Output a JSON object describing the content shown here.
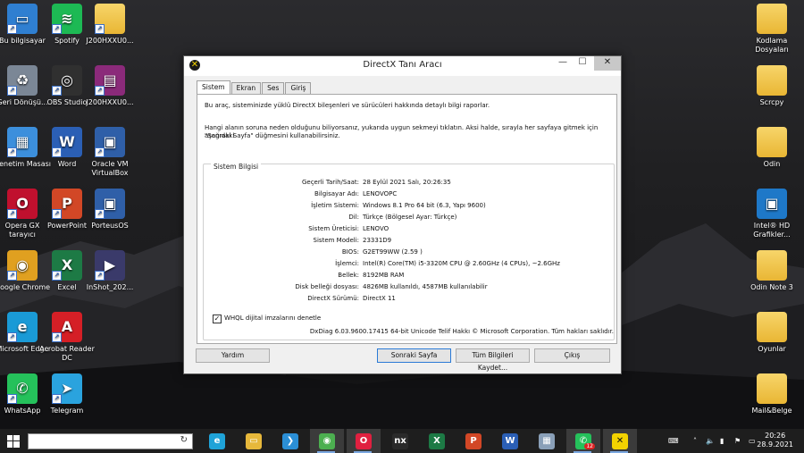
{
  "desktop": {
    "icons_left": [
      {
        "label": "Bu bilgisayar",
        "icon": "computer-icon"
      },
      {
        "label": "Spotify",
        "icon": "spotify-icon"
      },
      {
        "label": "J200HXXU0...",
        "icon": "folder-icon"
      },
      {
        "label": "Geri Dönüşü...",
        "icon": "recycle-bin-icon"
      },
      {
        "label": "OBS Studio",
        "icon": "obs-icon"
      },
      {
        "label": "J200HXXU0...",
        "icon": "winrar-icon"
      },
      {
        "label": "Denetim Masası",
        "icon": "control-panel-icon"
      },
      {
        "label": "Word",
        "icon": "word-icon"
      },
      {
        "label": "Oracle VM VirtualBox",
        "icon": "virtualbox-icon"
      },
      {
        "label": "Opera GX tarayıcı",
        "icon": "opera-gx-icon"
      },
      {
        "label": "PowerPoint",
        "icon": "powerpoint-icon"
      },
      {
        "label": "PorteusOS",
        "icon": "virtualbox-icon"
      },
      {
        "label": "Google Chrome",
        "icon": "chrome-icon"
      },
      {
        "label": "Excel",
        "icon": "excel-icon"
      },
      {
        "label": "InShot_202...",
        "icon": "video-file-icon"
      },
      {
        "label": "Microsoft Edge",
        "icon": "edge-icon"
      },
      {
        "label": "Acrobat Reader DC",
        "icon": "acrobat-icon"
      },
      {
        "label": "WhatsApp",
        "icon": "whatsapp-icon"
      },
      {
        "label": "Telegram",
        "icon": "telegram-icon"
      }
    ],
    "icons_right": [
      {
        "label": "Kodlama Dosyaları",
        "icon": "folder-icon"
      },
      {
        "label": "Scrcpy",
        "icon": "folder-icon"
      },
      {
        "label": "Odin",
        "icon": "folder-icon"
      },
      {
        "label": "Intel® HD Grafikler...",
        "icon": "intel-graphics-icon"
      },
      {
        "label": "Odin Note 3",
        "icon": "folder-icon"
      },
      {
        "label": "Oyunlar",
        "icon": "folder-icon"
      },
      {
        "label": "Mail&Belge",
        "icon": "folder-icon"
      }
    ]
  },
  "window": {
    "title": "DirectX Tanı Aracı",
    "controls": {
      "minimize": "—",
      "maximize": "☐",
      "close": "✕"
    },
    "tabs": [
      "Sistem",
      "Ekran",
      "Ses",
      "Giriş"
    ],
    "intro1": "Bu araç, sisteminizde yüklü DirectX bileşenleri ve sürücüleri hakkında detaylı bilgi raporlar.",
    "intro2a": "Hangi alanın soruna neden olduğunu biliyorsanız, yukarıda uygun sekmeyi tıklatın.  Aksi halde, sırayla her sayfaya gitmek için aşağıdaki",
    "intro2b": "\"Sonraki Sayfa\" düğmesini kullanabilirsiniz.",
    "group_title": "Sistem Bilgisi",
    "info": [
      {
        "key": "Geçerli Tarih/Saat:",
        "value": "28 Eylül 2021 Salı, 20:26:35"
      },
      {
        "key": "Bilgisayar Adı:",
        "value": "LENOVOPC"
      },
      {
        "key": "İşletim Sistemi:",
        "value": "Windows 8.1 Pro 64 bit (6.3, Yapı 9600)"
      },
      {
        "key": "Dil:",
        "value": "Türkçe (Bölgesel Ayar: Türkçe)"
      },
      {
        "key": "Sistem Üreticisi:",
        "value": "LENOVO"
      },
      {
        "key": "Sistem Modeli:",
        "value": "23331D9"
      },
      {
        "key": "BIOS:",
        "value": "G2ET99WW (2.59 )"
      },
      {
        "key": "İşlemci:",
        "value": "Intel(R) Core(TM) i5-3320M CPU @ 2.60GHz (4 CPUs), ~2.6GHz"
      },
      {
        "key": "Bellek:",
        "value": "8192MB RAM"
      },
      {
        "key": "Disk belleği dosyası:",
        "value": "4826MB kullanıldı, 4587MB kullanılabilir"
      },
      {
        "key": "DirectX Sürümü:",
        "value": "DirectX 11"
      }
    ],
    "whql_label": "WHQL dijital imzalarını denetle",
    "whql_checked": true,
    "copyright": "DxDiag 6.03.9600.17415 64-bit Unicode  Telif Hakkı © Microsoft Corporation. Tüm hakları saklıdır.",
    "buttons": {
      "help": "Yardım",
      "next": "Sonraki Sayfa",
      "save_all": "Tüm Bilgileri Kaydet...",
      "exit": "Çıkış"
    }
  },
  "taskbar": {
    "start_icon": "windows-logo-icon",
    "refresh_icon": "↻",
    "apps": [
      {
        "name": "edge",
        "icon": "edge-icon",
        "color": "#1fa3d8"
      },
      {
        "name": "explorer",
        "icon": "file-explorer-icon",
        "color": "#e7b83b"
      },
      {
        "name": "vscode",
        "icon": "vscode-icon",
        "color": "#2b8fd6"
      },
      {
        "name": "chrome",
        "icon": "chrome-icon",
        "color": "#4caf50",
        "active": true
      },
      {
        "name": "opera-gx",
        "icon": "opera-gx-icon",
        "color": "#e02040",
        "active": true
      },
      {
        "name": "nox",
        "icon": "nox-icon",
        "color": "#2a2a2a"
      },
      {
        "name": "excel",
        "icon": "excel-icon",
        "color": "#1d7a45"
      },
      {
        "name": "powerpoint",
        "icon": "powerpoint-icon",
        "color": "#d24726"
      },
      {
        "name": "word",
        "icon": "word-icon",
        "color": "#2b5fb5"
      },
      {
        "name": "control-panel",
        "icon": "control-panel-icon",
        "color": "#8aa0b8"
      },
      {
        "name": "whatsapp",
        "icon": "whatsapp-icon",
        "color": "#25c15b",
        "active": true,
        "badge": "12"
      },
      {
        "name": "dxdiag",
        "icon": "directx-icon",
        "color": "#f2d200",
        "active": true
      }
    ],
    "time": "20:26",
    "date": "28.9.2021"
  }
}
